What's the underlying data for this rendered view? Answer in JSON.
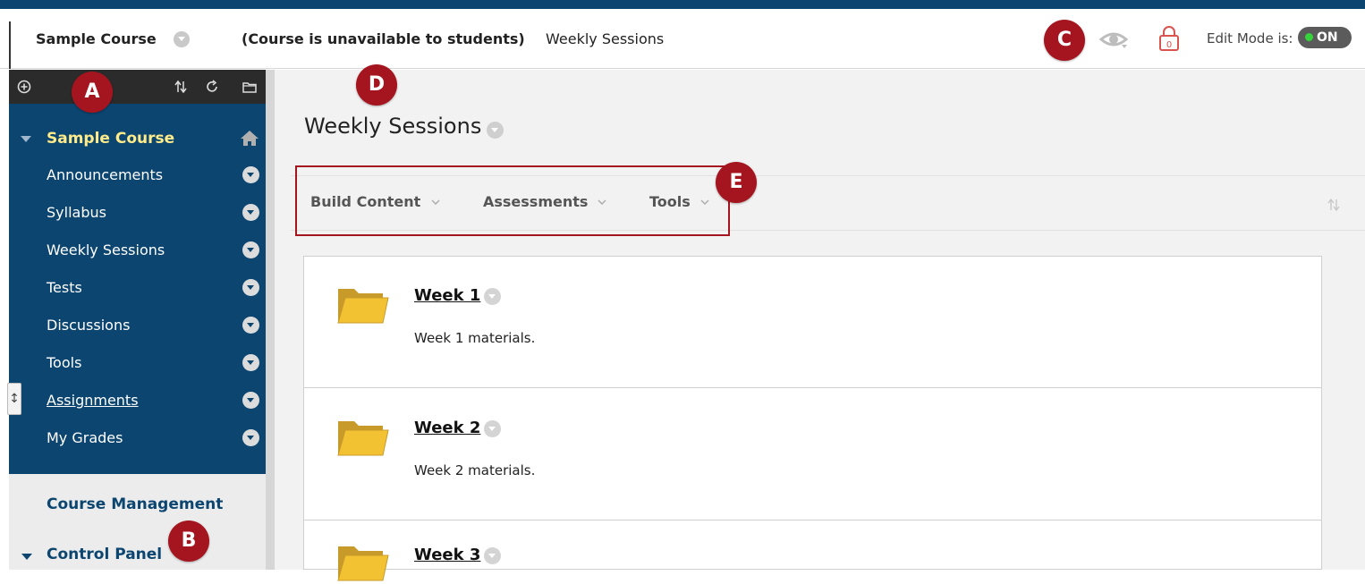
{
  "header": {
    "course_name": "Sample Course",
    "availability": "(Course is unavailable to students)",
    "current_page": "Weekly Sessions",
    "edit_mode_label": "Edit Mode is:",
    "edit_mode_state": "ON",
    "lock_count": "0"
  },
  "sidebar": {
    "course_title": "Sample Course",
    "items": [
      {
        "label": "Announcements"
      },
      {
        "label": "Syllabus"
      },
      {
        "label": "Weekly Sessions"
      },
      {
        "label": "Tests"
      },
      {
        "label": "Discussions"
      },
      {
        "label": "Tools"
      },
      {
        "label": "Assignments"
      },
      {
        "label": "My Grades"
      }
    ],
    "management_title": "Course Management",
    "control_panel": "Control Panel"
  },
  "main": {
    "page_title": "Weekly Sessions",
    "actions": [
      {
        "label": "Build Content"
      },
      {
        "label": "Assessments"
      },
      {
        "label": "Tools"
      }
    ],
    "items": [
      {
        "title": "Week 1",
        "description": "Week 1 materials."
      },
      {
        "title": "Week 2",
        "description": "Week 2 materials."
      },
      {
        "title": "Week 3",
        "description": ""
      }
    ]
  },
  "callouts": {
    "a": "A",
    "b": "B",
    "c": "C",
    "d": "D",
    "e": "E"
  },
  "colors": {
    "brand_blue": "#0b4570",
    "callout_red": "#a5151f",
    "course_title_yellow": "#ffeb8a",
    "toggle_on_green": "#35d43a"
  }
}
